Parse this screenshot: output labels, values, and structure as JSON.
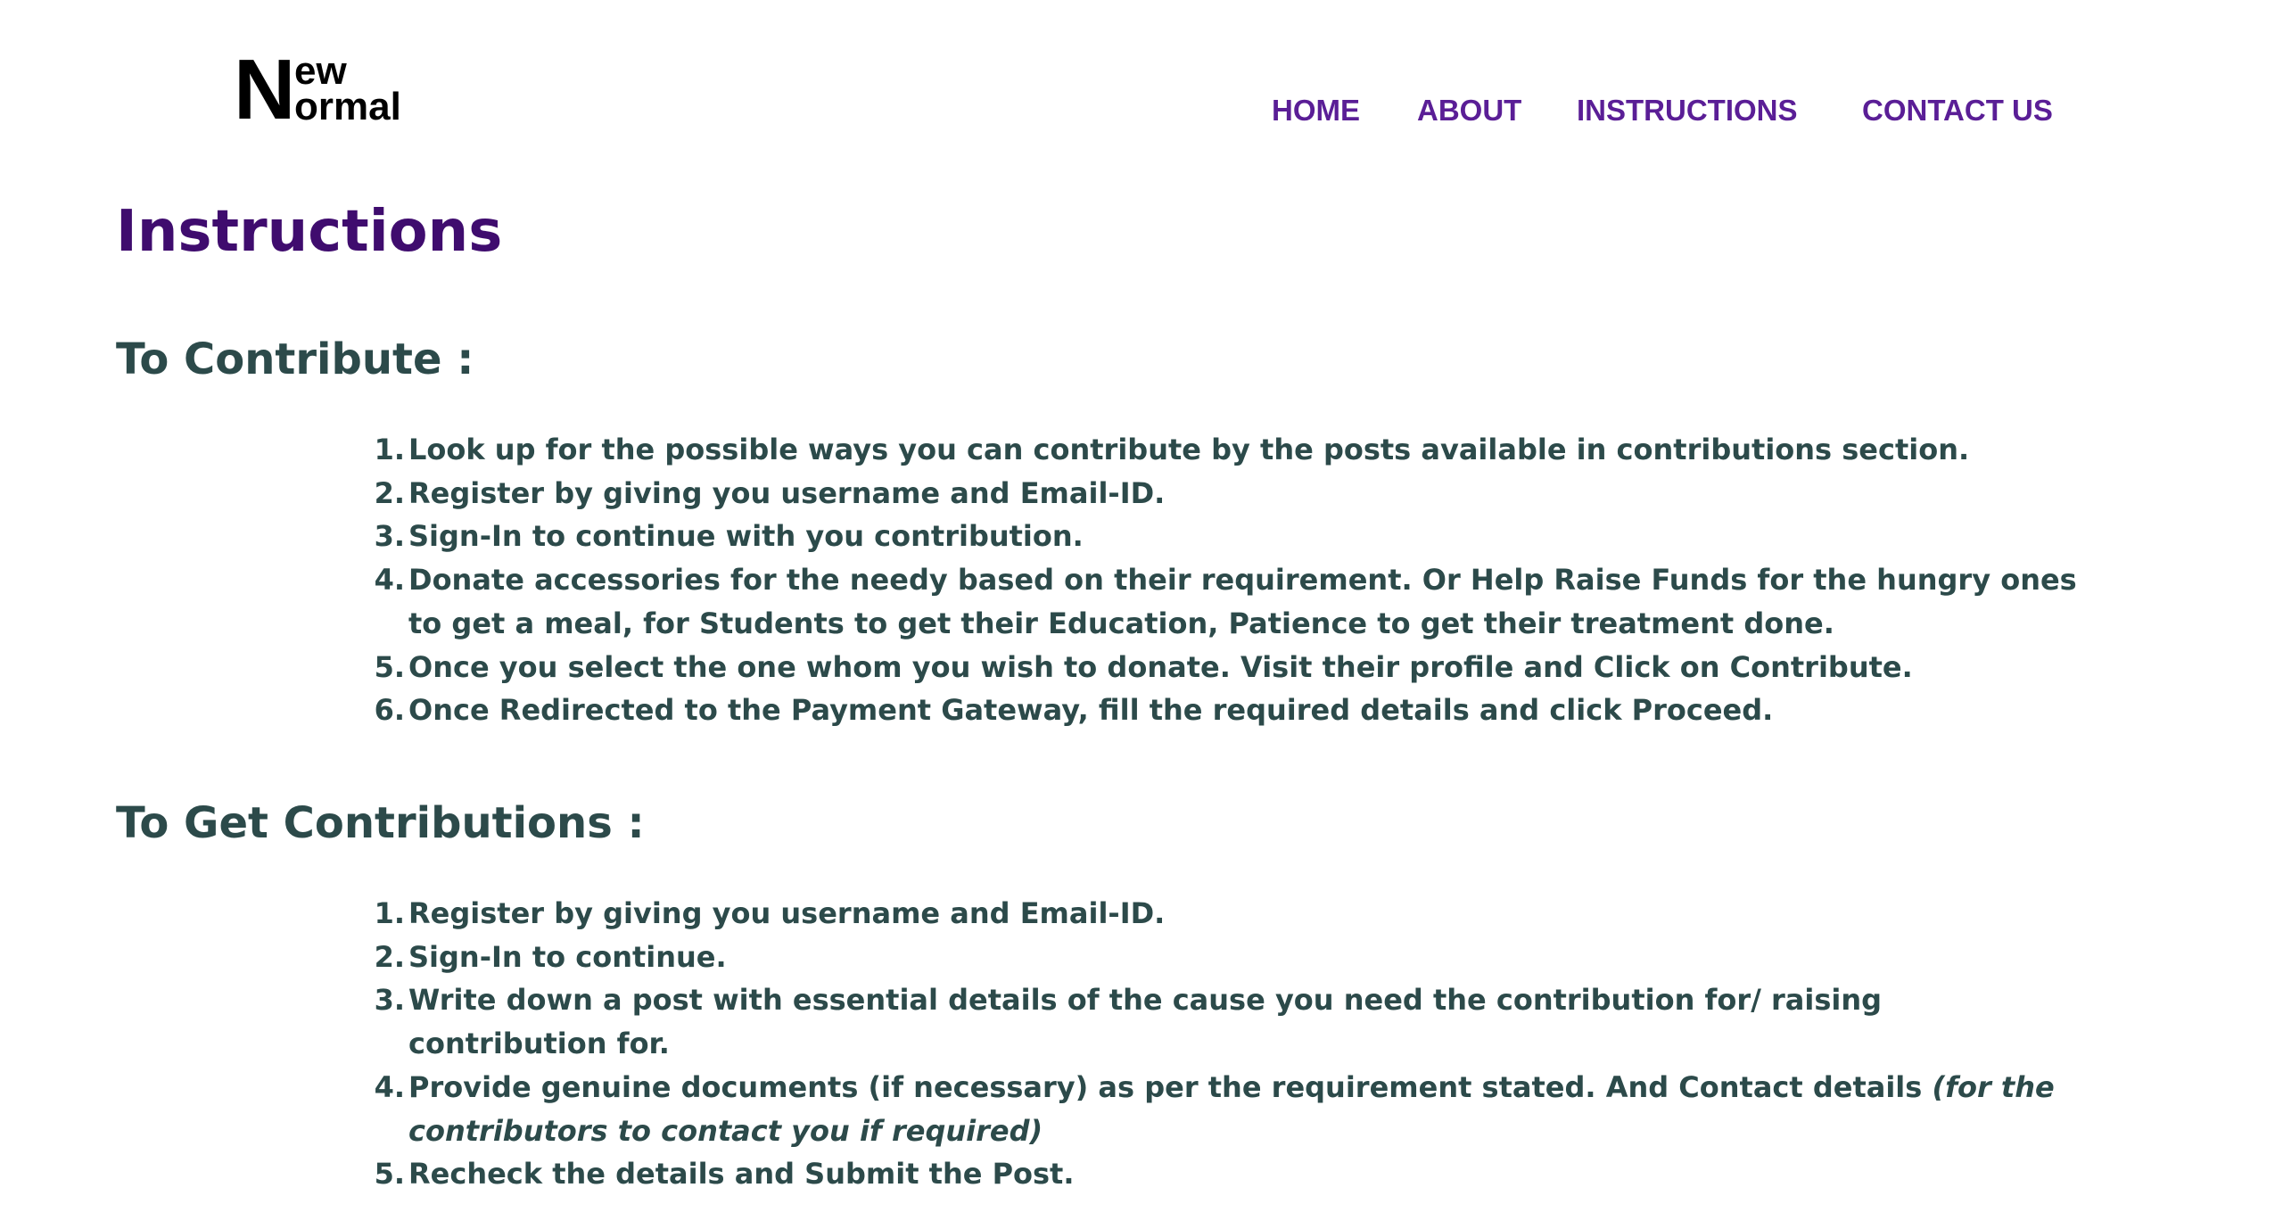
{
  "header": {
    "logo": {
      "big_letter": "N",
      "line1": "ew",
      "line2": "ormal"
    },
    "nav": [
      "HOME",
      "ABOUT",
      "INSTRUCTIONS",
      "CONTACT US"
    ]
  },
  "main": {
    "title": "Instructions",
    "sections": [
      {
        "title": "To Contribute :",
        "steps": [
          {
            "num": "1.",
            "text": "Look up for the possible ways you can contribute by the posts available in contributions section."
          },
          {
            "num": "2.",
            "text": "Register by giving you username and Email-ID."
          },
          {
            "num": "3.",
            "text": "Sign-In to continue with you contribution."
          },
          {
            "num": "4.",
            "text": "Donate accessories for the needy based on their requirement. Or Help Raise Funds for the hungry ones to get a meal, for Students to get their Education, Patience to get their treatment done."
          },
          {
            "num": "5.",
            "text": "Once you select the one whom you wish to donate. Visit their profile and Click on Contribute."
          },
          {
            "num": "6.",
            "text": "Once Redirected to the Payment Gateway, fill the required details and click Proceed."
          }
        ]
      },
      {
        "title": "To Get Contributions :",
        "steps": [
          {
            "num": "1.",
            "text": "Register by giving you username and Email-ID."
          },
          {
            "num": "2.",
            "text": "Sign-In to continue."
          },
          {
            "num": "3.",
            "text": "Write down a post with essential details of the cause you need the contribution for/ raising contribution for."
          },
          {
            "num": "4.",
            "text": "Provide genuine documents (if necessary) as per the requirement stated. And Contact details ",
            "italic": "(for the contributors to contact you if required)"
          },
          {
            "num": "5.",
            "text": "Recheck the details and Submit the Post."
          }
        ]
      }
    ]
  },
  "colors": {
    "nav_link": "#5a1e96",
    "page_title": "#3f0c6e",
    "body_text": "#2c4a4a",
    "logo": "#000000",
    "background": "#ffffff"
  }
}
